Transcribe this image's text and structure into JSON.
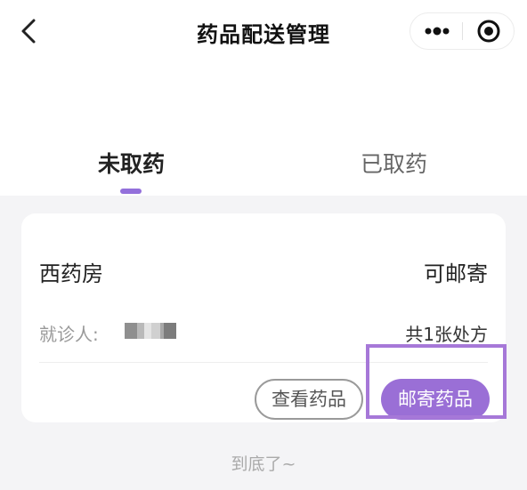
{
  "navbar": {
    "title": "药品配送管理",
    "back_icon": "chevron-left-icon",
    "more_icon": "more-dots-icon",
    "target_icon": "target-icon"
  },
  "tabs": [
    {
      "label": "未取药",
      "active": true
    },
    {
      "label": "已取药",
      "active": false
    }
  ],
  "card": {
    "pharmacy": "西药房",
    "shipping_status": "可邮寄",
    "patient_label": "就诊人:",
    "prescription_count": "共1张处方",
    "view_button": "查看药品",
    "mail_button": "邮寄药品"
  },
  "footer": {
    "end_text": "到底了~"
  },
  "colors": {
    "accent": "#9a6fd6",
    "tab_indicator": "#9370db",
    "highlight_frame": "#a678d8",
    "page_background": "#f4f4f6"
  }
}
